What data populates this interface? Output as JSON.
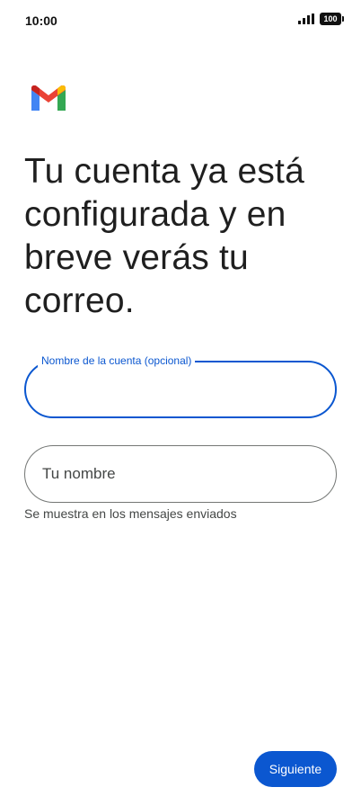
{
  "status_bar": {
    "time": "10:00",
    "battery": "100"
  },
  "logo": {
    "icon": "gmail-logo-icon",
    "colors": {
      "blue": "#4285F4",
      "red": "#EA4335",
      "green": "#34A853",
      "yellow": "#FBBC04",
      "dark_red": "#C5221F"
    }
  },
  "headline": "Tu cuenta ya está configurada y en breve verás tu correo.",
  "account_name_field": {
    "label": "Nombre de la cuenta (opcional)",
    "value": ""
  },
  "your_name_field": {
    "placeholder": "Tu nombre",
    "value": "",
    "helper": "Se muestra en los mensajes enviados"
  },
  "next_button": {
    "label": "Siguiente"
  },
  "colors": {
    "accent": "#0b57d0",
    "text": "#1f1f1f",
    "outline": "#747775"
  }
}
